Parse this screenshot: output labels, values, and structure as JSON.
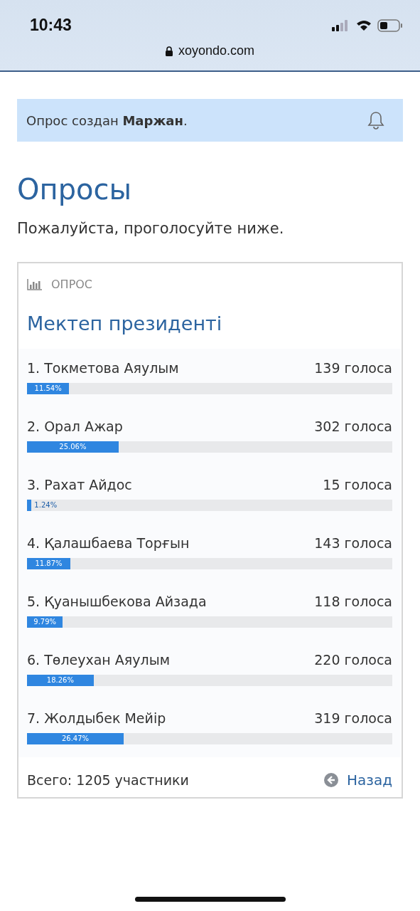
{
  "status_bar": {
    "time": "10:43",
    "url": "xoyondo.com"
  },
  "notice": {
    "text": "Опрос создан **Маржан**."
  },
  "heading": "Опросы",
  "subtitle": "Пожалуйста, проголосуйте ниже.",
  "poll": {
    "label": "ОПРОС",
    "title": "Мектеп президенті",
    "options": [
      {
        "name": "1. Токметова Аяулым",
        "votes": "139 голоса",
        "percent": "11.54%",
        "level": 0.1154
      },
      {
        "name": "2. Орал Ажар",
        "votes": "302 голоса",
        "percent": "25.06%",
        "level": 0.2506
      },
      {
        "name": "3. Рахат Айдос",
        "votes": "15 голоса",
        "percent": "1.24%",
        "level": 0.0124
      },
      {
        "name": "4. Қалашбаева Торғын",
        "votes": "143 голоса",
        "percent": "11.87%",
        "level": 0.1187
      },
      {
        "name": "5. Қуанышбекова Айзада",
        "votes": "118 голоса",
        "percent": "9.79%",
        "level": 0.0979
      },
      {
        "name": "6. Төлеухан Аяулым",
        "votes": "220 голоса",
        "percent": "18.26%",
        "level": 0.1826
      },
      {
        "name": "7. Жолдыбек Мейір",
        "votes": "319 голоса",
        "percent": "26.47%",
        "level": 0.2647
      }
    ],
    "total": "Всего: 1205 участники",
    "back": "Назад"
  }
}
